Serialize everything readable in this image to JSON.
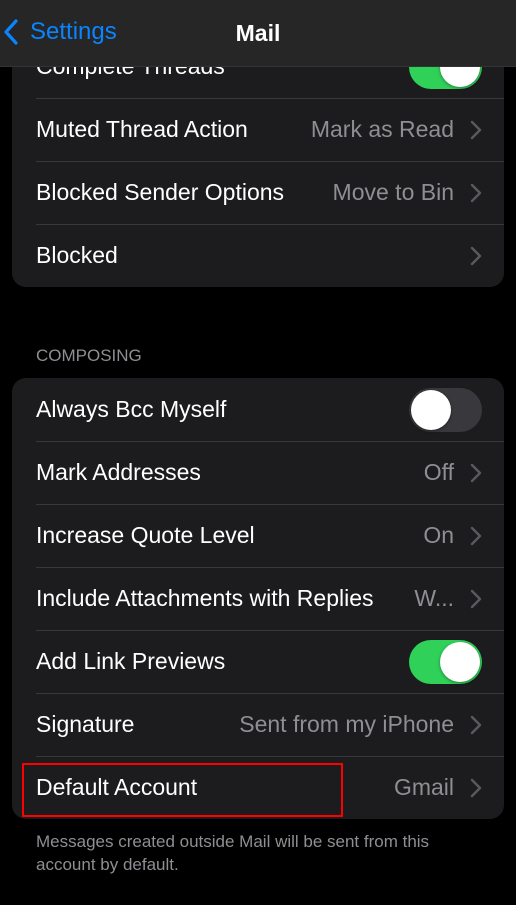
{
  "navbar": {
    "back_label": "Settings",
    "title": "Mail"
  },
  "threading": {
    "rows": [
      {
        "label": "Complete Threads",
        "type": "toggle",
        "on": true
      },
      {
        "label": "Muted Thread Action",
        "value": "Mark as Read"
      },
      {
        "label": "Blocked Sender Options",
        "value": "Move to Bin"
      },
      {
        "label": "Blocked",
        "value": ""
      }
    ]
  },
  "composing": {
    "header": "COMPOSING",
    "rows": [
      {
        "label": "Always Bcc Myself",
        "type": "toggle",
        "on": false
      },
      {
        "label": "Mark Addresses",
        "value": "Off"
      },
      {
        "label": "Increase Quote Level",
        "value": "On"
      },
      {
        "label": "Include Attachments with Replies",
        "value": "W..."
      },
      {
        "label": "Add Link Previews",
        "type": "toggle",
        "on": true
      },
      {
        "label": "Signature",
        "value": "Sent from my iPhone"
      },
      {
        "label": "Default Account",
        "value": "Gmail"
      }
    ],
    "footer": "Messages created outside Mail will be sent from this account by default."
  },
  "colors": {
    "accent": "#0a84ff",
    "toggle_on": "#30d158",
    "highlight": "#ff0000"
  }
}
